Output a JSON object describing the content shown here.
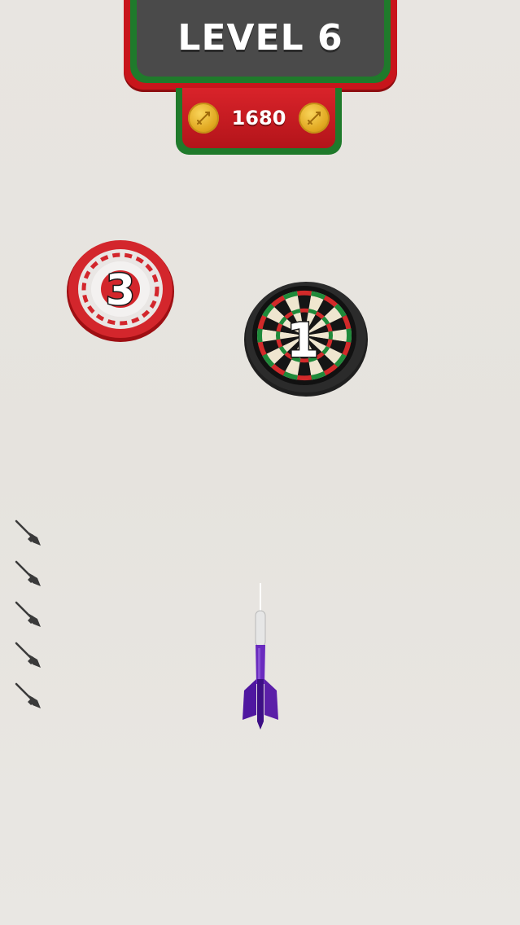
{
  "hud": {
    "level_label": "LEVEL 6",
    "coins": "1680"
  },
  "targets": [
    {
      "label": "3",
      "kind": "red-white-target"
    },
    {
      "label": "1",
      "kind": "dartboard"
    }
  ],
  "darts_remaining": 5,
  "icons": {
    "coin": "dart-coin-icon",
    "remaining_dart": "dart-icon",
    "player_dart": "purple-dart"
  },
  "colors": {
    "frame_red": "#c8151b",
    "frame_green": "#1f7a2b",
    "plate_gray": "#4a4a4a",
    "coin_gold": "#e1a821",
    "dart_purple": "#5b1fa8"
  }
}
